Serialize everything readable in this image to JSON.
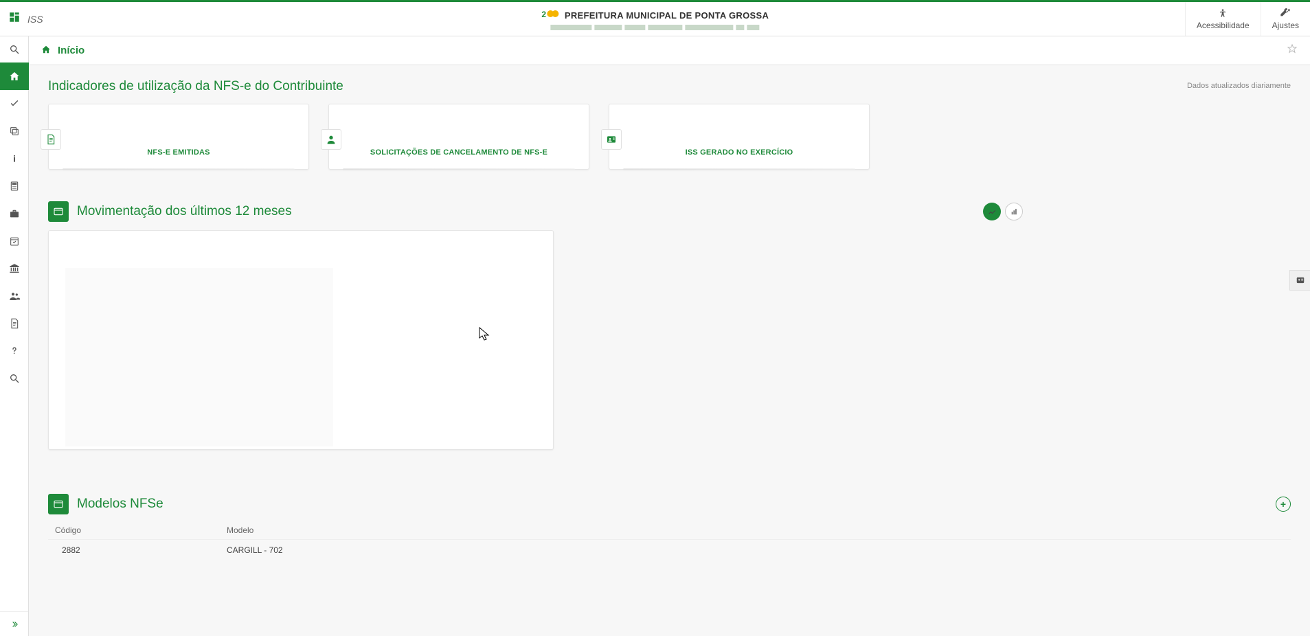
{
  "header": {
    "module": "ISS",
    "title": "PREFEITURA MUNICIPAL DE PONTA GROSSA",
    "accessibility_label": "Acessibilidade",
    "settings_label": "Ajustes"
  },
  "breadcrumb": {
    "home_label": "Início"
  },
  "indicators": {
    "section_title": "Indicadores de utilização da NFS-e do Contribuinte",
    "updated_note": "Dados atualizados diariamente",
    "cards": [
      {
        "label": "NFS-E EMITIDAS"
      },
      {
        "label": "SOLICITAÇÕES DE CANCELAMENTO DE NFS-E"
      },
      {
        "label": "ISS GERADO NO EXERCÍCIO"
      }
    ]
  },
  "movement": {
    "title": "Movimentação dos últimos 12 meses"
  },
  "models": {
    "title": "Modelos NFSe",
    "col_code": "Código",
    "col_model": "Modelo",
    "rows": [
      {
        "code": "2882",
        "model": "CARGILL - 702"
      }
    ]
  },
  "chart_data": {
    "type": "line",
    "title": "Movimentação dos últimos 12 meses",
    "categories": [],
    "series": [],
    "note": "chart area shown empty / loading in screenshot"
  }
}
